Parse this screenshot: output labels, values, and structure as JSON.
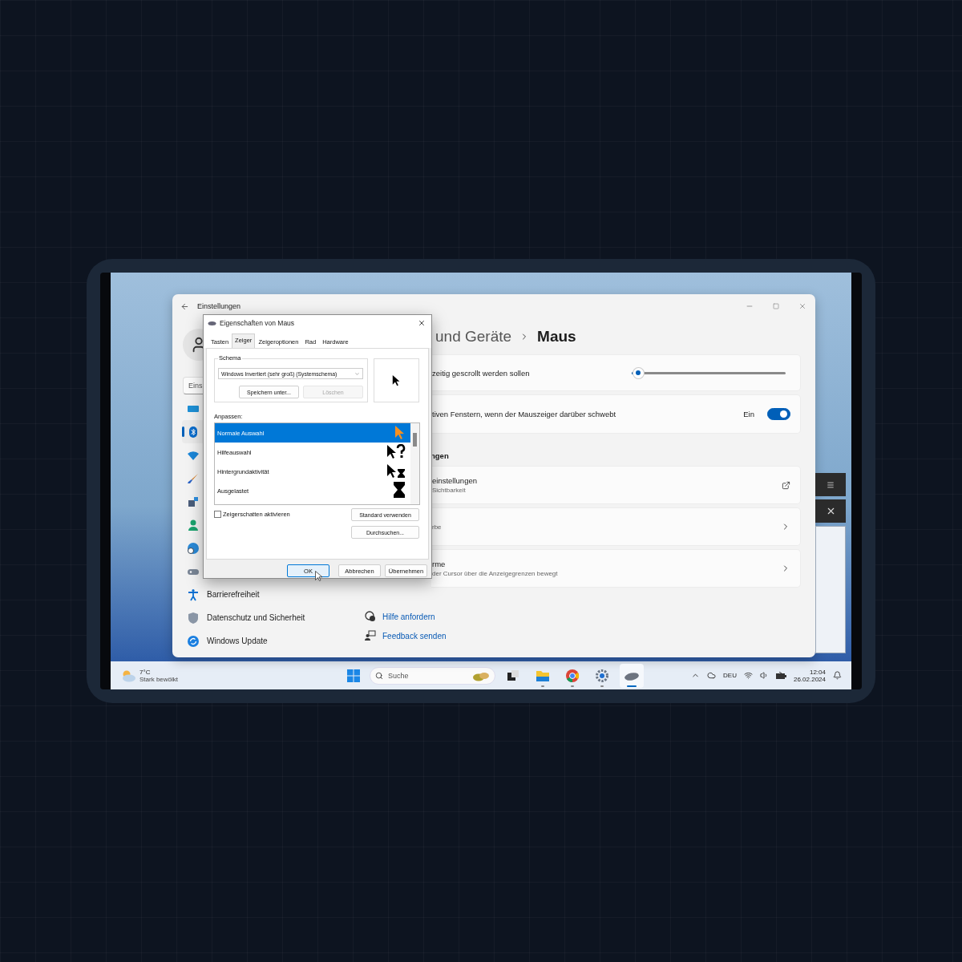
{
  "settings_window": {
    "title": "Einstellungen",
    "search": {
      "value": "Eins"
    },
    "nav": [
      {
        "selected": false
      },
      {
        "selected": true
      },
      {
        "selected": false
      },
      {
        "selected": false
      },
      {
        "selected": false
      },
      {
        "selected": false
      },
      {
        "selected": false
      },
      {
        "selected": false
      },
      {
        "label": "Barrierefreiheit",
        "selected": false
      },
      {
        "label": "Datenschutz und Sicherheit",
        "selected": false
      },
      {
        "label": "Windows Update",
        "selected": false
      }
    ],
    "breadcrumb": {
      "parent": "und Geräte",
      "current": "Maus"
    },
    "cards": [
      {
        "kind": "slider",
        "text": "zeitig gescrollt werden sollen",
        "level": 0.04
      },
      {
        "kind": "toggle",
        "text": "tiven Fenstern, wenn der Mauszeiger darüber schwebt",
        "state_label": "Ein",
        "on": true
      }
    ],
    "section_title": "ngen",
    "link_cards": [
      {
        "kind": "external",
        "title": "einstellungen",
        "subtitle": "Sichtbarkeit"
      },
      {
        "kind": "chevron",
        "subtitle": "rbe"
      },
      {
        "kind": "chevron",
        "title": "rme",
        "subtitle": "der Cursor über die Anzeigegrenzen bewegt"
      }
    ],
    "help_links": [
      "Hilfe anfordern",
      "Feedback senden"
    ]
  },
  "dialog": {
    "title": "Eigenschaften von Maus",
    "tabs": [
      {
        "label": "Tasten",
        "selected": false
      },
      {
        "label": "Zeiger",
        "selected": true
      },
      {
        "label": "Zeigeroptionen",
        "selected": false
      },
      {
        "label": "Rad",
        "selected": false
      },
      {
        "label": "Hardware",
        "selected": false
      }
    ],
    "schema": {
      "label": "Schema",
      "value": "Windows Invertiert (sehr groß) (Systemschema)",
      "buttons": [
        {
          "label": "Speichern unter...",
          "disabled": false
        },
        {
          "label": "Löschen",
          "disabled": true
        }
      ]
    },
    "customize_label": "Anpassen:",
    "cursor_list": [
      {
        "label": "Normale Auswahl",
        "selected": true
      },
      {
        "label": "Hilfeauswahl",
        "selected": false
      },
      {
        "label": "Hintergrundaktivität",
        "selected": false
      },
      {
        "label": "Ausgelastet",
        "selected": false
      }
    ],
    "shadow_checkbox": {
      "label": "Zeigerschatten aktivieren",
      "checked": false
    },
    "side_buttons": [
      "Standard verwenden",
      "Durchsuchen..."
    ],
    "footer_buttons": [
      {
        "label": "OK",
        "default": true
      },
      {
        "label": "Abbrechen",
        "default": false
      },
      {
        "label": "Übernehmen",
        "default": false
      }
    ]
  },
  "taskbar": {
    "weather": {
      "temperature": "7°C",
      "condition": "Stark bewölkt"
    },
    "search": {
      "placeholder": "Suche"
    },
    "apps": [
      {
        "running": false,
        "active": false
      },
      {
        "running": true,
        "active": false
      },
      {
        "running": true,
        "active": false
      },
      {
        "running": true,
        "active": false
      },
      {
        "running": true,
        "active": true
      }
    ],
    "language": "DEU",
    "time": "12:04",
    "date": "26.02.2024"
  }
}
